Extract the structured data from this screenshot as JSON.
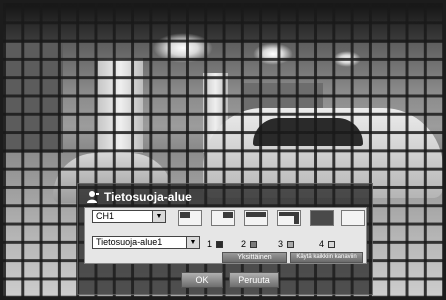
{
  "dialog": {
    "title": "Tietosuoja-alue",
    "title_icon": "user-icon",
    "channel_select": {
      "value": "CH1"
    },
    "area_select": {
      "value": "Tietosuoja-alue1"
    },
    "areas": [
      {
        "number": "1",
        "color": "#2b2b2b"
      },
      {
        "number": "2",
        "color": "#7a7a7a"
      },
      {
        "number": "3",
        "color": "#a9a9a9"
      },
      {
        "number": "4",
        "color": "#d8d8d8"
      }
    ],
    "single_button": "Yksittäinen",
    "apply_all_button": "Käytä kaikkiin kanaviin",
    "ok_button": "OK",
    "cancel_button": "Peruuta"
  }
}
